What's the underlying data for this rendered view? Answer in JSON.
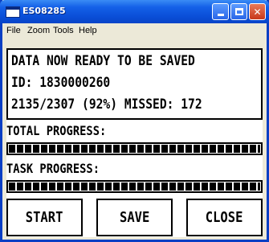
{
  "window": {
    "title": "ES08285",
    "controls": {
      "minimize": "",
      "maximize": "",
      "close": "✕"
    }
  },
  "menu": {
    "items": [
      "File",
      "Zoom",
      "Tools",
      "Help"
    ]
  },
  "status": {
    "line1": "DATA NOW READY TO BE SAVED",
    "line2": "ID: 1830000260",
    "line3": "2135/2307 (92%) MISSED: 172"
  },
  "progress": {
    "total_label": "TOTAL PROGRESS:",
    "total_fraction": 1.0,
    "task_label": "TASK PROGRESS:",
    "task_fraction": 1.0
  },
  "buttons": {
    "start": "START",
    "save": "SAVE",
    "close": "CLOSE"
  },
  "colors": {
    "titlebar": "#0a4fd8",
    "close_button": "#c8381a",
    "frame": "#0a3fc4"
  }
}
